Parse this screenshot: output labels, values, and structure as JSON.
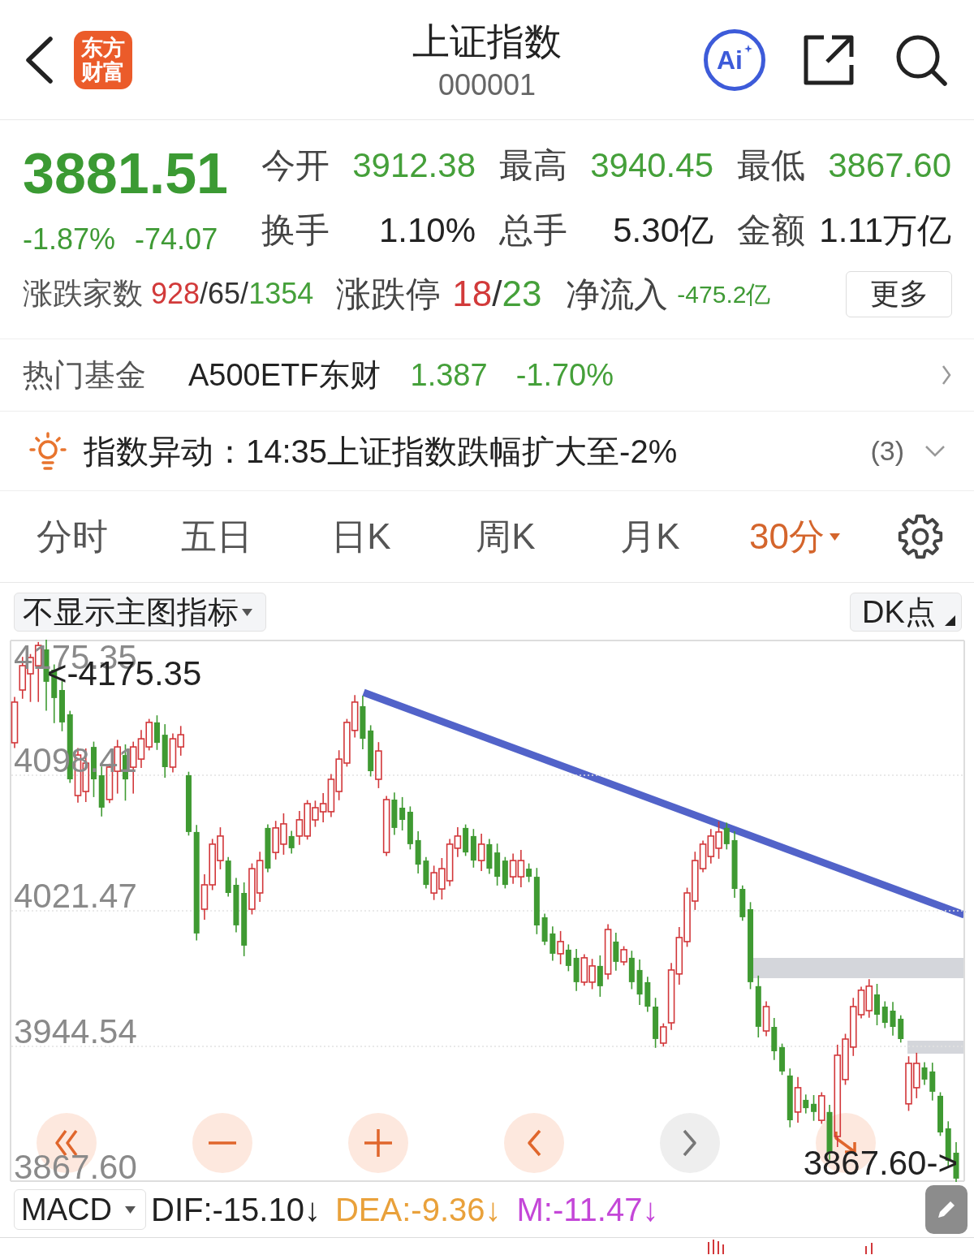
{
  "header": {
    "logo": [
      "东方",
      "财富"
    ],
    "title": "上证指数",
    "code": "000001",
    "ai_label": "Ai"
  },
  "quote": {
    "price": "3881.51",
    "change_percent": "-1.87%",
    "change": "-74.07"
  },
  "stats": [
    [
      {
        "label": "今开",
        "value": "3912.38",
        "color": "#45a03a"
      },
      {
        "label": "最高",
        "value": "3940.45",
        "color": "#45a03a"
      },
      {
        "label": "最低",
        "value": "3867.60",
        "color": "#45a03a"
      }
    ],
    [
      {
        "label": "换手",
        "value": "1.10%",
        "color": "#222222"
      },
      {
        "label": "总手",
        "value": "5.30亿",
        "color": "#222222"
      },
      {
        "label": "金额",
        "value": "1.11万亿",
        "color": "#222222"
      }
    ]
  ],
  "breadth": {
    "label": "涨跌家数",
    "parts": [
      {
        "text": "928",
        "color": "#d23a3a"
      },
      {
        "text": "/65/",
        "color": "#333333"
      },
      {
        "text": "1354",
        "color": "#45a03a"
      }
    ]
  },
  "limit_moves": {
    "label": "涨跌停",
    "parts": [
      {
        "text": "18",
        "color": "#d23a3a"
      },
      {
        "text": "/",
        "color": "#333333"
      },
      {
        "text": "23",
        "color": "#45a03a"
      }
    ]
  },
  "net_inflow": {
    "label": "净流入",
    "value": "-475.2亿"
  },
  "more_button": "更多",
  "hot_fund": {
    "label": "热门基金",
    "name": "A500ETF东财",
    "price": "1.387",
    "change": "-1.70%"
  },
  "alert": {
    "text": "指数异动：14:35上证指数跌幅扩大至-2%",
    "count": "(3)",
    "expanded": false
  },
  "period_tabs": [
    {
      "label": "分时",
      "selected": false,
      "dropdown": false
    },
    {
      "label": "五日",
      "selected": false,
      "dropdown": false
    },
    {
      "label": "日K",
      "selected": false,
      "dropdown": false
    },
    {
      "label": "周K",
      "selected": false,
      "dropdown": false
    },
    {
      "label": "月K",
      "selected": false,
      "dropdown": false
    },
    {
      "label": "30分",
      "selected": true,
      "dropdown": true
    }
  ],
  "chart": {
    "indicator_menu": "不显示主图指标",
    "dk_button": "DK点",
    "axis_max_label": "4175.35",
    "high_marker": "<-4175.35",
    "low_marker": "3867.60->",
    "chart_data": {
      "type": "candlestick",
      "grid": true,
      "ohlc": [
        [
          4116.8,
          4142.9,
          4113.8,
          4139.9
        ],
        [
          4146.8,
          4165.6,
          4141.8,
          4160.6
        ],
        [
          4156.0,
          4167.2,
          4140.0,
          4165.2
        ],
        [
          4160.6,
          4174.0,
          4140.0,
          4172.1
        ],
        [
          4169.8,
          4175.35,
          4135.0,
          4151.4
        ],
        [
          4158.3,
          4161.3,
          4128.0,
          4142.2
        ],
        [
          4146.8,
          4151.8,
          4123.4,
          4128.4
        ],
        [
          4133.0,
          4135.0,
          4094.1,
          4096.1
        ],
        [
          4086.9,
          4113.9,
          4082.9,
          4109.9
        ],
        [
          4089.2,
          4113.6,
          4083.2,
          4105.3
        ],
        [
          4114.5,
          4117.5,
          4086.0,
          4096.1
        ],
        [
          4098.4,
          4103.4,
          4075.0,
          4080.0
        ],
        [
          4084.6,
          4105.0,
          4082.6,
          4103.0
        ],
        [
          4100.7,
          4118.5,
          4088.0,
          4114.5
        ],
        [
          4109.9,
          4115.9,
          4084.0,
          4096.1
        ],
        [
          4103.0,
          4117.5,
          4088.0,
          4114.5
        ],
        [
          4107.6,
          4124.1,
          4102.6,
          4119.1
        ],
        [
          4114.5,
          4130.4,
          4112.5,
          4128.4
        ],
        [
          4128.4,
          4132.4,
          4112.8,
          4116.8
        ],
        [
          4121.4,
          4127.4,
          4097.0,
          4103.0
        ],
        [
          4103.0,
          4122.1,
          4100.0,
          4119.1
        ],
        [
          4114.5,
          4126.4,
          4109.5,
          4121.4
        ],
        [
          4098.4,
          4100.4,
          4064.2,
          4066.2
        ],
        [
          4066.2,
          4070.2,
          4004.6,
          4008.6
        ],
        [
          4022.4,
          4042.2,
          4016.4,
          4036.2
        ],
        [
          4036.2,
          4062.3,
          4033.2,
          4059.3
        ],
        [
          4050.0,
          4068.9,
          4045.0,
          4063.9
        ],
        [
          4050.0,
          4052.0,
          4029.6,
          4031.6
        ],
        [
          4036.2,
          4040.2,
          4009.2,
          4013.2
        ],
        [
          4031.6,
          4037.6,
          3995.7,
          4001.7
        ],
        [
          4022.4,
          4048.4,
          4019.4,
          4045.4
        ],
        [
          4031.6,
          4055.0,
          4026.6,
          4050.0
        ],
        [
          4068.5,
          4070.5,
          4043.4,
          4045.4
        ],
        [
          4054.6,
          4072.5,
          4050.6,
          4068.5
        ],
        [
          4059.3,
          4076.8,
          4053.3,
          4070.8
        ],
        [
          4063.9,
          4066.9,
          4054.0,
          4057.0
        ],
        [
          4063.9,
          4078.1,
          4058.9,
          4073.1
        ],
        [
          4063.9,
          4084.3,
          4061.9,
          4082.3
        ],
        [
          4073.1,
          4084.0,
          4069.1,
          4080.0
        ],
        [
          4077.7,
          4088.3,
          4071.7,
          4082.3
        ],
        [
          4077.7,
          4099.1,
          4074.7,
          4096.1
        ],
        [
          4089.2,
          4112.6,
          4084.2,
          4107.6
        ],
        [
          4105.3,
          4130.4,
          4103.3,
          4128.4
        ],
        [
          4123.8,
          4143.9,
          4119.8,
          4139.9
        ],
        [
          4137.6,
          4143.6,
          4113.1,
          4119.1
        ],
        [
          4123.8,
          4126.8,
          4097.7,
          4100.7
        ],
        [
          4096.1,
          4117.2,
          4091.1,
          4112.2
        ],
        [
          4054.6,
          4086.6,
          4052.6,
          4084.6
        ],
        [
          4084.6,
          4088.6,
          4064.5,
          4068.5
        ],
        [
          4080.0,
          4086.0,
          4067.1,
          4073.1
        ],
        [
          4077.7,
          4080.7,
          4056.3,
          4059.3
        ],
        [
          4061.6,
          4066.6,
          4042.7,
          4047.7
        ],
        [
          4050.0,
          4052.0,
          4034.2,
          4036.2
        ],
        [
          4031.6,
          4047.1,
          4027.6,
          4043.1
        ],
        [
          4033.9,
          4051.4,
          4027.9,
          4045.4
        ],
        [
          4038.5,
          4062.3,
          4035.5,
          4059.3
        ],
        [
          4057.0,
          4068.9,
          4052.0,
          4063.9
        ],
        [
          4068.5,
          4070.5,
          4052.6,
          4054.6
        ],
        [
          4063.9,
          4067.9,
          4046.0,
          4050.0
        ],
        [
          4050.0,
          4065.3,
          4044.0,
          4059.3
        ],
        [
          4059.3,
          4062.3,
          4042.4,
          4045.4
        ],
        [
          4054.6,
          4059.6,
          4035.8,
          4040.8
        ],
        [
          4050.0,
          4052.0,
          4034.2,
          4036.2
        ],
        [
          4040.8,
          4054.0,
          4036.8,
          4050.0
        ],
        [
          4040.8,
          4056.0,
          4034.8,
          4050.0
        ],
        [
          4045.4,
          4048.4,
          4037.8,
          4040.8
        ],
        [
          4040.8,
          4045.8,
          4008.2,
          4013.2
        ],
        [
          4017.8,
          4019.8,
          4002.0,
          4004.0
        ],
        [
          4008.6,
          4012.6,
          3993.1,
          3997.1
        ],
        [
          3997.1,
          4010.0,
          3991.1,
          4004.0
        ],
        [
          3999.4,
          4002.4,
          3987.2,
          3990.2
        ],
        [
          3994.8,
          3999.8,
          3976.0,
          3981.0
        ],
        [
          3981.0,
          3996.8,
          3979.0,
          3994.8
        ],
        [
          3981.0,
          3994.2,
          3977.0,
          3990.2
        ],
        [
          3990.2,
          3996.2,
          3972.7,
          3978.7
        ],
        [
          3985.6,
          4013.9,
          3982.6,
          4010.9
        ],
        [
          4004.0,
          4009.0,
          3987.5,
          3992.5
        ],
        [
          3992.5,
          4001.4,
          3990.5,
          3999.4
        ],
        [
          3994.8,
          3998.8,
          3977.0,
          3981.0
        ],
        [
          3987.9,
          3993.9,
          3968.0,
          3974.0
        ],
        [
          3981.0,
          3984.0,
          3964.1,
          3967.1
        ],
        [
          3967.1,
          3972.1,
          3943.7,
          3948.7
        ],
        [
          3946.4,
          3957.6,
          3944.4,
          3955.6
        ],
        [
          3957.9,
          3991.9,
          3953.9,
          3987.9
        ],
        [
          3985.6,
          4012.3,
          3979.6,
          4006.3
        ],
        [
          4004.0,
          4034.6,
          4001.0,
          4031.6
        ],
        [
          4027.0,
          4055.0,
          4022.0,
          4050.0
        ],
        [
          4045.4,
          4061.3,
          4043.4,
          4059.3
        ],
        [
          4052.3,
          4067.9,
          4048.3,
          4063.9
        ],
        [
          4057.0,
          4072.2,
          4051.0,
          4066.2
        ],
        [
          4068.5,
          4071.5,
          4056.3,
          4059.3
        ],
        [
          4061.6,
          4066.6,
          4028.9,
          4033.9
        ],
        [
          4033.9,
          4035.9,
          4015.8,
          4017.8
        ],
        [
          4022.4,
          4026.4,
          3977.0,
          3981.0
        ],
        [
          3978.7,
          3984.7,
          3949.6,
          3955.6
        ],
        [
          3953.3,
          3970.1,
          3950.3,
          3967.1
        ],
        [
          3955.6,
          3960.6,
          3936.8,
          3941.8
        ],
        [
          3944.1,
          3946.1,
          3928.3,
          3930.3
        ],
        [
          3928.0,
          3932.0,
          3898.6,
          3902.6
        ],
        [
          3907.3,
          3927.1,
          3901.3,
          3921.1
        ],
        [
          3914.2,
          3917.2,
          3906.5,
          3909.5
        ],
        [
          3911.9,
          3916.9,
          3902.3,
          3907.3
        ],
        [
          3902.6,
          3918.5,
          3900.6,
          3916.5
        ],
        [
          3907.3,
          3911.3,
          3880.2,
          3884.2
        ],
        [
          3893.4,
          3945.5,
          3887.4,
          3939.5
        ],
        [
          3925.7,
          3951.7,
          3922.7,
          3948.7
        ],
        [
          3944.1,
          3972.1,
          3939.1,
          3967.1
        ],
        [
          3962.5,
          3978.4,
          3960.5,
          3976.4
        ],
        [
          3964.8,
          3982.7,
          3960.8,
          3978.7
        ],
        [
          3974.0,
          3980.0,
          3956.5,
          3962.5
        ],
        [
          3967.1,
          3970.1,
          3954.9,
          3957.9
        ],
        [
          3964.8,
          3969.8,
          3950.6,
          3955.6
        ],
        [
          3960.2,
          3962.2,
          3946.7,
          3948.7
        ],
        [
          3911.9,
          3938.9,
          3907.9,
          3934.9
        ],
        [
          3921.1,
          3940.9,
          3915.1,
          3934.9
        ],
        [
          3932.6,
          3935.6,
          3922.7,
          3925.7
        ],
        [
          3930.3,
          3935.3,
          3913.8,
          3918.8
        ],
        [
          3916.5,
          3918.5,
          3893.7,
          3895.7
        ],
        [
          3898.0,
          3902.0,
          3875.6,
          3879.6
        ],
        [
          3884.2,
          3890.2,
          3867.6,
          3869.5
        ]
      ],
      "ylim": [
        3867.6,
        4175.35
      ],
      "yticks": [
        {
          "value": 4098.41,
          "label": "4098.41"
        },
        {
          "value": 4021.47,
          "label": "4021.47"
        },
        {
          "value": 3944.54,
          "label": "3944.54"
        },
        {
          "value": 3867.6,
          "label": "3867.60"
        }
      ]
    },
    "controls": [
      {
        "kind": "rewind",
        "disabled": false
      },
      {
        "kind": "zoom_out",
        "disabled": false
      },
      {
        "kind": "zoom_in",
        "disabled": false
      },
      {
        "kind": "previous",
        "disabled": false
      },
      {
        "kind": "next",
        "disabled": true
      },
      {
        "kind": "jump",
        "disabled": false
      }
    ]
  },
  "macd": {
    "selector": "MACD",
    "readings": [
      {
        "text": "DIF:-15.10↓",
        "color": "#222222"
      },
      {
        "text": "DEA:-9.36↓",
        "color": "#e9a13b"
      },
      {
        "text": "M:-11.47↓",
        "color": "#c447d8"
      }
    ]
  }
}
